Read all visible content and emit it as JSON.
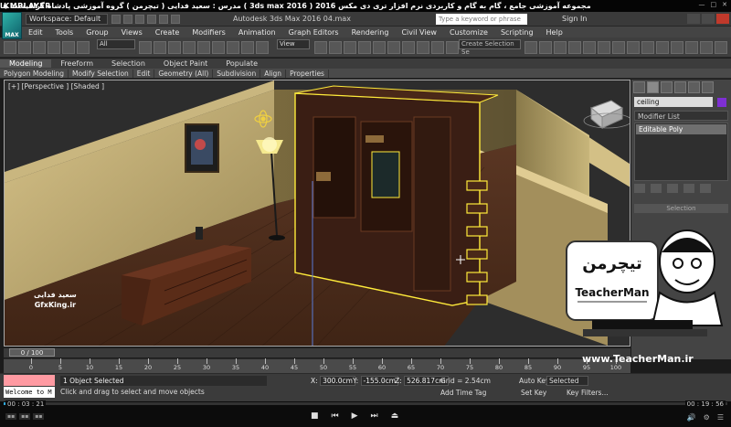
{
  "player": {
    "logo": "KMPLAYER",
    "title": "مجموعه آموزشی جامع ، گام به گام و کاربردی نرم افزار تری دی مکس 2016  ( 3ds max 2016 )  مدرس : سعید فدایی ( تیچرمن ) گروه آموزشی پادشاه گرافیست ها",
    "elapsed": "00 : 03 : 21",
    "total": "00 : 19 : 56"
  },
  "max": {
    "logo": "MAX",
    "workspace": "Workspace: Default",
    "title": "Autodesk 3ds Max 2016     04.max",
    "search_placeholder": "Type a keyword or phrase",
    "signin": "Sign In"
  },
  "menu": [
    "Edit",
    "Tools",
    "Group",
    "Views",
    "Create",
    "Modifiers",
    "Animation",
    "Graph Editors",
    "Rendering",
    "Civil View",
    "Customize",
    "Scripting",
    "Help"
  ],
  "toolbar": {
    "selection_filter": "All",
    "ref_coord": "View",
    "create_selection_set": "Create Selection Se"
  },
  "ribbon": {
    "tabs": [
      "Modeling",
      "Freeform",
      "Selection",
      "Object Paint",
      "Populate"
    ],
    "active_tab": "Modeling",
    "sub": [
      "Polygon Modeling",
      "Modify Selection",
      "Edit",
      "Geometry (All)",
      "Subdivision",
      "Align",
      "Properties"
    ]
  },
  "viewport": {
    "label": "[+] [Perspective ] [Shaded ]",
    "watermark_fa": "سعید فدایی",
    "watermark_en": "GfxKing.ir"
  },
  "command_panel": {
    "object_name": "ceiling",
    "modifier_list": "Modifier List",
    "stack_item": "Editable Poly",
    "rollout": "Selection"
  },
  "timeline": {
    "frame": "0 / 100",
    "ticks": [
      "0",
      "5",
      "10",
      "15",
      "20",
      "25",
      "30",
      "35",
      "40",
      "45",
      "50",
      "55",
      "60",
      "65",
      "70",
      "75",
      "80",
      "85",
      "90",
      "95",
      "100"
    ]
  },
  "status": {
    "selected": "1 Object Selected",
    "prompt": "Click and drag to select and move objects",
    "maxscript": "Welcome to M",
    "x": "300.0cm",
    "y": "-155.0cm",
    "z": "526.817cm",
    "grid": "Grid = 2.54cm",
    "add_time_tag": "Add Time Tag",
    "auto_key": "Auto Key",
    "set_key": "Set Key",
    "selected_dd": "Selected",
    "key_filters": "Key Filters..."
  },
  "badge": {
    "name_fa": "تیچرمن",
    "name_en": "TeacherMan",
    "url": "www.TeacherMan.ir"
  },
  "colors": {
    "selection": "#ffeb3b",
    "object_color": "#7e2fd3"
  }
}
